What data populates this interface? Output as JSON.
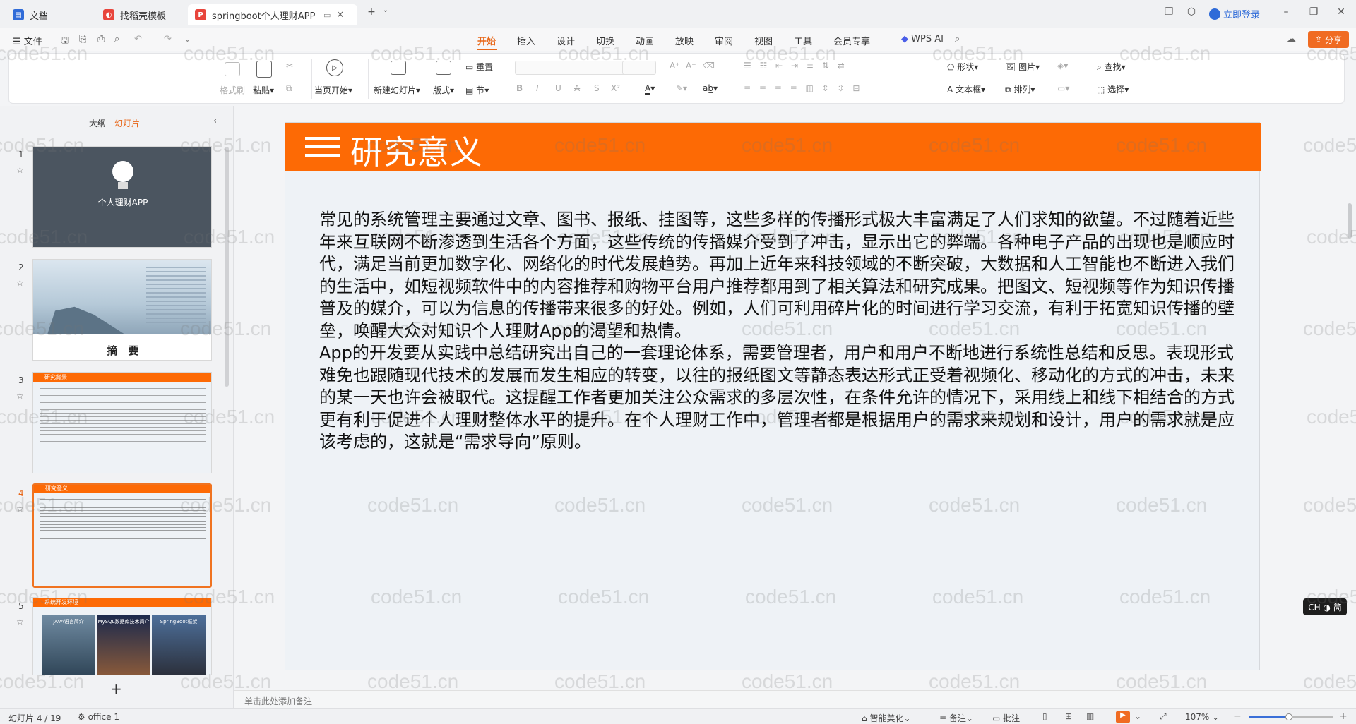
{
  "tabs": [
    {
      "label": "文档",
      "icon_color": "#2f6bd8"
    },
    {
      "label": "找稻壳模板",
      "icon_color": "#e8453c"
    },
    {
      "label": "springboot个人理财APP PF",
      "icon_color": "#e8453c"
    }
  ],
  "window": {
    "login": "立即登录"
  },
  "menu": {
    "file": "文件",
    "items": [
      "开始",
      "插入",
      "设计",
      "切换",
      "动画",
      "放映",
      "审阅",
      "视图",
      "工具",
      "会员专享"
    ],
    "wps_ai": "WPS AI",
    "share": "分享"
  },
  "ribbon": {
    "format_painter": "格式刷",
    "paste": "粘贴",
    "from_start": "当页开始",
    "new_slide": "新建幻灯片",
    "layout": "版式",
    "reset": "重置",
    "section": "节",
    "shape": "形状",
    "picture": "图片",
    "find": "查找",
    "textbox": "文本框",
    "arrange": "排列",
    "select": "选择"
  },
  "leftpane": {
    "outline": "大纲",
    "slides": "幻灯片",
    "add": "+"
  },
  "thumbs": {
    "t1_title": "个人理财APP",
    "t2_title": "摘　要",
    "t3_head": "研究背景",
    "t4_head": "研究意义",
    "t5_head": "系统开发环境",
    "t5_labels": [
      "JAVA语言简介",
      "MySQL数据库技术简介",
      "SpringBoot框架"
    ]
  },
  "slide": {
    "title": "研究意义",
    "paragraph1": "常见的系统管理主要通过文章、图书、报纸、挂图等，这些多样的传播形式极大丰富满足了人们求知的欲望。不过随着近些年来互联网不断渗透到生活各个方面，这些传统的传播媒介受到了冲击，显示出它的弊端。各种电子产品的出现也是顺应时代，满足当前更加数字化、网络化的时代发展趋势。再加上近年来科技领域的不断突破，大数据和人工智能也不断进入我们的生活中，如短视频软件中的内容推荐和购物平台用户推荐都用到了相关算法和研究成果。把图文、短视频等作为知识传播普及的媒介，可以为信息的传播带来很多的好处。例如，人们可利用碎片化的时间进行学习交流，有利于拓宽知识传播的壁垒，唤醒大众对知识个人理财App的渴望和热情。",
    "paragraph2": "App的开发要从实践中总结研究出自己的一套理论体系，需要管理者，用户和用户不断地进行系统性总结和反思。表现形式难免也跟随现代技术的发展而发生相应的转变，以往的报纸图文等静态表达形式正受着视频化、移动化的方式的冲击，未来的某一天也许会被取代。这提醒工作者更加关注公众需求的多层次性，在条件允许的情况下，采用线上和线下相结合的方式更有利于促进个人理财整体水平的提升。在个人理财工作中，管理者都是根据用户的需求来规划和设计，用户的需求就是应该考虑的，这就是“需求导向”原则。"
  },
  "watermark": "code51.cn",
  "ime": "CH ◑ 简",
  "notes_placeholder": "单击此处添加备注",
  "status": {
    "slide_count": "幻灯片 4 / 19",
    "theme": "office 1",
    "beautify": "智能美化",
    "notes": "备注",
    "comments": "批注",
    "zoom": "107%"
  }
}
